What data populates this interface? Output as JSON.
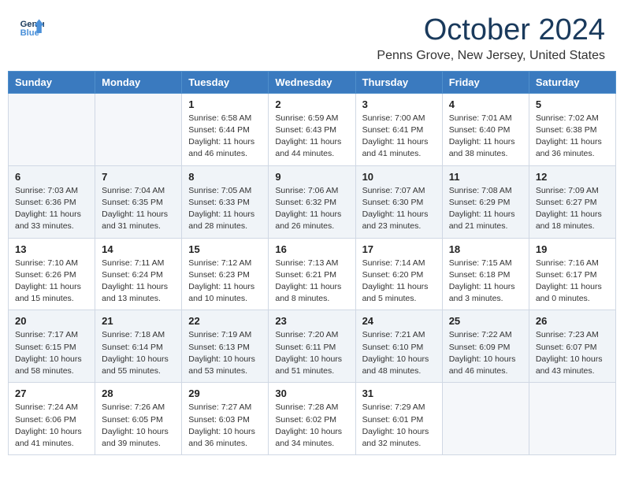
{
  "header": {
    "logo_line1": "General",
    "logo_line2": "Blue",
    "month_title": "October 2024",
    "location": "Penns Grove, New Jersey, United States"
  },
  "days_of_week": [
    "Sunday",
    "Monday",
    "Tuesday",
    "Wednesday",
    "Thursday",
    "Friday",
    "Saturday"
  ],
  "weeks": [
    [
      {
        "day": "",
        "sunrise": "",
        "sunset": "",
        "daylight": ""
      },
      {
        "day": "",
        "sunrise": "",
        "sunset": "",
        "daylight": ""
      },
      {
        "day": "1",
        "sunrise": "Sunrise: 6:58 AM",
        "sunset": "Sunset: 6:44 PM",
        "daylight": "Daylight: 11 hours and 46 minutes."
      },
      {
        "day": "2",
        "sunrise": "Sunrise: 6:59 AM",
        "sunset": "Sunset: 6:43 PM",
        "daylight": "Daylight: 11 hours and 44 minutes."
      },
      {
        "day": "3",
        "sunrise": "Sunrise: 7:00 AM",
        "sunset": "Sunset: 6:41 PM",
        "daylight": "Daylight: 11 hours and 41 minutes."
      },
      {
        "day": "4",
        "sunrise": "Sunrise: 7:01 AM",
        "sunset": "Sunset: 6:40 PM",
        "daylight": "Daylight: 11 hours and 38 minutes."
      },
      {
        "day": "5",
        "sunrise": "Sunrise: 7:02 AM",
        "sunset": "Sunset: 6:38 PM",
        "daylight": "Daylight: 11 hours and 36 minutes."
      }
    ],
    [
      {
        "day": "6",
        "sunrise": "Sunrise: 7:03 AM",
        "sunset": "Sunset: 6:36 PM",
        "daylight": "Daylight: 11 hours and 33 minutes."
      },
      {
        "day": "7",
        "sunrise": "Sunrise: 7:04 AM",
        "sunset": "Sunset: 6:35 PM",
        "daylight": "Daylight: 11 hours and 31 minutes."
      },
      {
        "day": "8",
        "sunrise": "Sunrise: 7:05 AM",
        "sunset": "Sunset: 6:33 PM",
        "daylight": "Daylight: 11 hours and 28 minutes."
      },
      {
        "day": "9",
        "sunrise": "Sunrise: 7:06 AM",
        "sunset": "Sunset: 6:32 PM",
        "daylight": "Daylight: 11 hours and 26 minutes."
      },
      {
        "day": "10",
        "sunrise": "Sunrise: 7:07 AM",
        "sunset": "Sunset: 6:30 PM",
        "daylight": "Daylight: 11 hours and 23 minutes."
      },
      {
        "day": "11",
        "sunrise": "Sunrise: 7:08 AM",
        "sunset": "Sunset: 6:29 PM",
        "daylight": "Daylight: 11 hours and 21 minutes."
      },
      {
        "day": "12",
        "sunrise": "Sunrise: 7:09 AM",
        "sunset": "Sunset: 6:27 PM",
        "daylight": "Daylight: 11 hours and 18 minutes."
      }
    ],
    [
      {
        "day": "13",
        "sunrise": "Sunrise: 7:10 AM",
        "sunset": "Sunset: 6:26 PM",
        "daylight": "Daylight: 11 hours and 15 minutes."
      },
      {
        "day": "14",
        "sunrise": "Sunrise: 7:11 AM",
        "sunset": "Sunset: 6:24 PM",
        "daylight": "Daylight: 11 hours and 13 minutes."
      },
      {
        "day": "15",
        "sunrise": "Sunrise: 7:12 AM",
        "sunset": "Sunset: 6:23 PM",
        "daylight": "Daylight: 11 hours and 10 minutes."
      },
      {
        "day": "16",
        "sunrise": "Sunrise: 7:13 AM",
        "sunset": "Sunset: 6:21 PM",
        "daylight": "Daylight: 11 hours and 8 minutes."
      },
      {
        "day": "17",
        "sunrise": "Sunrise: 7:14 AM",
        "sunset": "Sunset: 6:20 PM",
        "daylight": "Daylight: 11 hours and 5 minutes."
      },
      {
        "day": "18",
        "sunrise": "Sunrise: 7:15 AM",
        "sunset": "Sunset: 6:18 PM",
        "daylight": "Daylight: 11 hours and 3 minutes."
      },
      {
        "day": "19",
        "sunrise": "Sunrise: 7:16 AM",
        "sunset": "Sunset: 6:17 PM",
        "daylight": "Daylight: 11 hours and 0 minutes."
      }
    ],
    [
      {
        "day": "20",
        "sunrise": "Sunrise: 7:17 AM",
        "sunset": "Sunset: 6:15 PM",
        "daylight": "Daylight: 10 hours and 58 minutes."
      },
      {
        "day": "21",
        "sunrise": "Sunrise: 7:18 AM",
        "sunset": "Sunset: 6:14 PM",
        "daylight": "Daylight: 10 hours and 55 minutes."
      },
      {
        "day": "22",
        "sunrise": "Sunrise: 7:19 AM",
        "sunset": "Sunset: 6:13 PM",
        "daylight": "Daylight: 10 hours and 53 minutes."
      },
      {
        "day": "23",
        "sunrise": "Sunrise: 7:20 AM",
        "sunset": "Sunset: 6:11 PM",
        "daylight": "Daylight: 10 hours and 51 minutes."
      },
      {
        "day": "24",
        "sunrise": "Sunrise: 7:21 AM",
        "sunset": "Sunset: 6:10 PM",
        "daylight": "Daylight: 10 hours and 48 minutes."
      },
      {
        "day": "25",
        "sunrise": "Sunrise: 7:22 AM",
        "sunset": "Sunset: 6:09 PM",
        "daylight": "Daylight: 10 hours and 46 minutes."
      },
      {
        "day": "26",
        "sunrise": "Sunrise: 7:23 AM",
        "sunset": "Sunset: 6:07 PM",
        "daylight": "Daylight: 10 hours and 43 minutes."
      }
    ],
    [
      {
        "day": "27",
        "sunrise": "Sunrise: 7:24 AM",
        "sunset": "Sunset: 6:06 PM",
        "daylight": "Daylight: 10 hours and 41 minutes."
      },
      {
        "day": "28",
        "sunrise": "Sunrise: 7:26 AM",
        "sunset": "Sunset: 6:05 PM",
        "daylight": "Daylight: 10 hours and 39 minutes."
      },
      {
        "day": "29",
        "sunrise": "Sunrise: 7:27 AM",
        "sunset": "Sunset: 6:03 PM",
        "daylight": "Daylight: 10 hours and 36 minutes."
      },
      {
        "day": "30",
        "sunrise": "Sunrise: 7:28 AM",
        "sunset": "Sunset: 6:02 PM",
        "daylight": "Daylight: 10 hours and 34 minutes."
      },
      {
        "day": "31",
        "sunrise": "Sunrise: 7:29 AM",
        "sunset": "Sunset: 6:01 PM",
        "daylight": "Daylight: 10 hours and 32 minutes."
      },
      {
        "day": "",
        "sunrise": "",
        "sunset": "",
        "daylight": ""
      },
      {
        "day": "",
        "sunrise": "",
        "sunset": "",
        "daylight": ""
      }
    ]
  ]
}
